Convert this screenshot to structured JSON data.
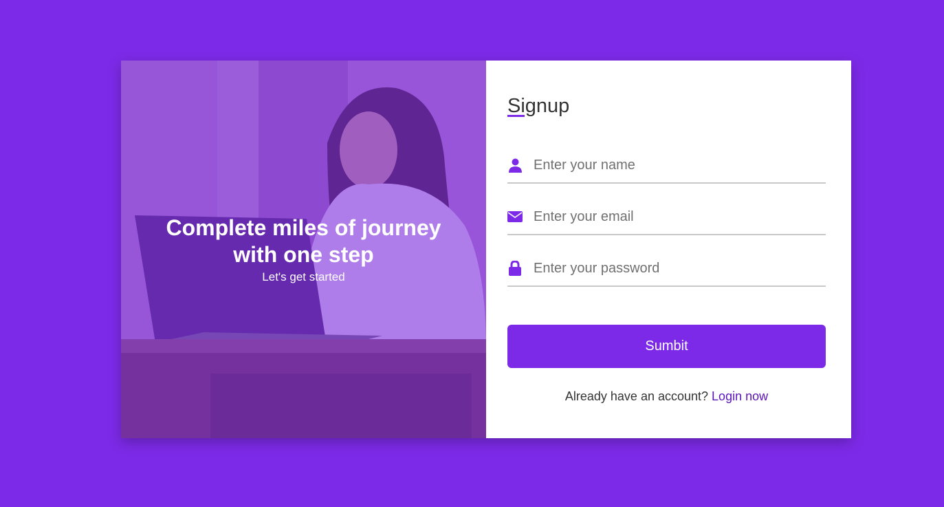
{
  "colors": {
    "background": "#7d2ae8",
    "accent": "#7d2ae8",
    "link": "#5b13b9"
  },
  "hero": {
    "headline": "Complete miles of journey with one step",
    "subtitle": "Let's get started"
  },
  "form": {
    "title": "Signup",
    "fields": [
      {
        "icon": "user-icon",
        "type": "text",
        "placeholder": "Enter your name",
        "value": ""
      },
      {
        "icon": "envelope-icon",
        "type": "email",
        "placeholder": "Enter your email",
        "value": ""
      },
      {
        "icon": "lock-icon",
        "type": "password",
        "placeholder": "Enter your password",
        "value": ""
      }
    ],
    "submit_label": "Sumbit",
    "login_prompt": "Already have an account?",
    "login_link": "Login now"
  }
}
